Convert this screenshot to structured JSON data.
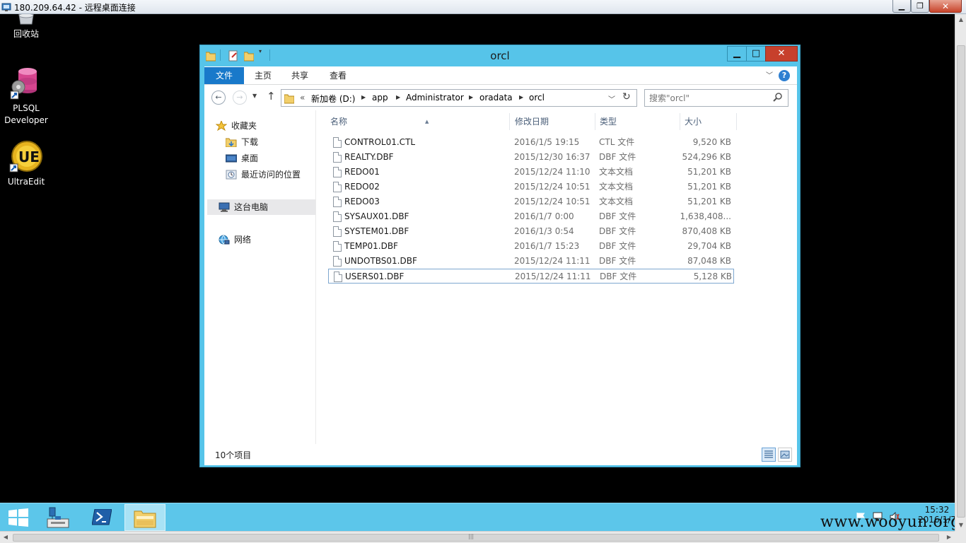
{
  "rdp": {
    "title": "180.209.64.42 - 远程桌面连接",
    "min_label": "▁",
    "max_label": "❐",
    "close_label": "✕"
  },
  "desktop": {
    "icons": [
      {
        "label": "回收站",
        "icon": "recycle-bin-icon"
      },
      {
        "label": "PLSQL Developer",
        "icon": "plsql-developer-icon"
      },
      {
        "label": "UltraEdit",
        "icon": "ultraedit-icon"
      }
    ]
  },
  "window": {
    "title": "orcl",
    "buttons": {
      "min": "▁",
      "max": "□",
      "close": "✕"
    },
    "ribbon_tabs": [
      "文件",
      "主页",
      "共享",
      "查看"
    ],
    "help_label": "?",
    "address": {
      "overflow": "«",
      "crumbs": [
        "新加卷 (D:)",
        "app",
        "Administrator",
        "oradata",
        "orcl"
      ]
    },
    "search": {
      "placeholder": "搜索\"orcl\"",
      "value": ""
    },
    "nav_pane": {
      "favorites": "收藏夹",
      "favorites_items": [
        "下载",
        "桌面",
        "最近访问的位置"
      ],
      "this_pc": "这台电脑",
      "network": "网络"
    },
    "columns": [
      "名称",
      "修改日期",
      "类型",
      "大小"
    ],
    "files": [
      {
        "name": "CONTROL01.CTL",
        "date": "2016/1/5 19:15",
        "type": "CTL 文件",
        "size": "9,520 KB"
      },
      {
        "name": "REALTY.DBF",
        "date": "2015/12/30 16:37",
        "type": "DBF 文件",
        "size": "524,296 KB"
      },
      {
        "name": "REDO01",
        "date": "2015/12/24 11:10",
        "type": "文本文档",
        "size": "51,201 KB"
      },
      {
        "name": "REDO02",
        "date": "2015/12/24 10:51",
        "type": "文本文档",
        "size": "51,201 KB"
      },
      {
        "name": "REDO03",
        "date": "2015/12/24 10:51",
        "type": "文本文档",
        "size": "51,201 KB"
      },
      {
        "name": "SYSAUX01.DBF",
        "date": "2016/1/7 0:00",
        "type": "DBF 文件",
        "size": "1,638,408..."
      },
      {
        "name": "SYSTEM01.DBF",
        "date": "2016/1/3 0:54",
        "type": "DBF 文件",
        "size": "870,408 KB"
      },
      {
        "name": "TEMP01.DBF",
        "date": "2016/1/7 15:23",
        "type": "DBF 文件",
        "size": "29,704 KB"
      },
      {
        "name": "UNDOTBS01.DBF",
        "date": "2015/12/24 11:11",
        "type": "DBF 文件",
        "size": "87,048 KB"
      },
      {
        "name": "USERS01.DBF",
        "date": "2015/12/24 11:11",
        "type": "DBF 文件",
        "size": "5,128 KB"
      }
    ],
    "selected_file": "USERS01.DBF",
    "status": "10个项目"
  },
  "taskbar": {
    "time": "15:32",
    "date": "2016/1/7",
    "watermark": "www.wooyun.org"
  },
  "colors": {
    "accent": "#56c4e9",
    "file_tab": "#1979ca",
    "close": "#c7402c"
  }
}
